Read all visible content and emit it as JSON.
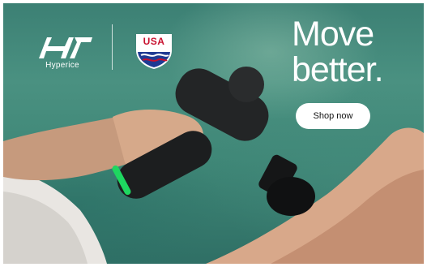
{
  "ad": {
    "brand_name": "Hyperice",
    "partner_logo_text": "USA",
    "headline_line1": "Move",
    "headline_line2": "better.",
    "cta_label": "Shop now"
  },
  "colors": {
    "water": "#3f8777",
    "text": "#ffffff",
    "button_bg": "#ffffff",
    "device": "#1c1e1f",
    "device_accent": "#1ed760",
    "usa_red": "#c8102e",
    "usa_blue": "#1f3a93"
  },
  "icons": {
    "brand": "hyperice-logo-icon",
    "partner": "usa-swimming-badge-icon",
    "product": "massage-gun-icon"
  }
}
